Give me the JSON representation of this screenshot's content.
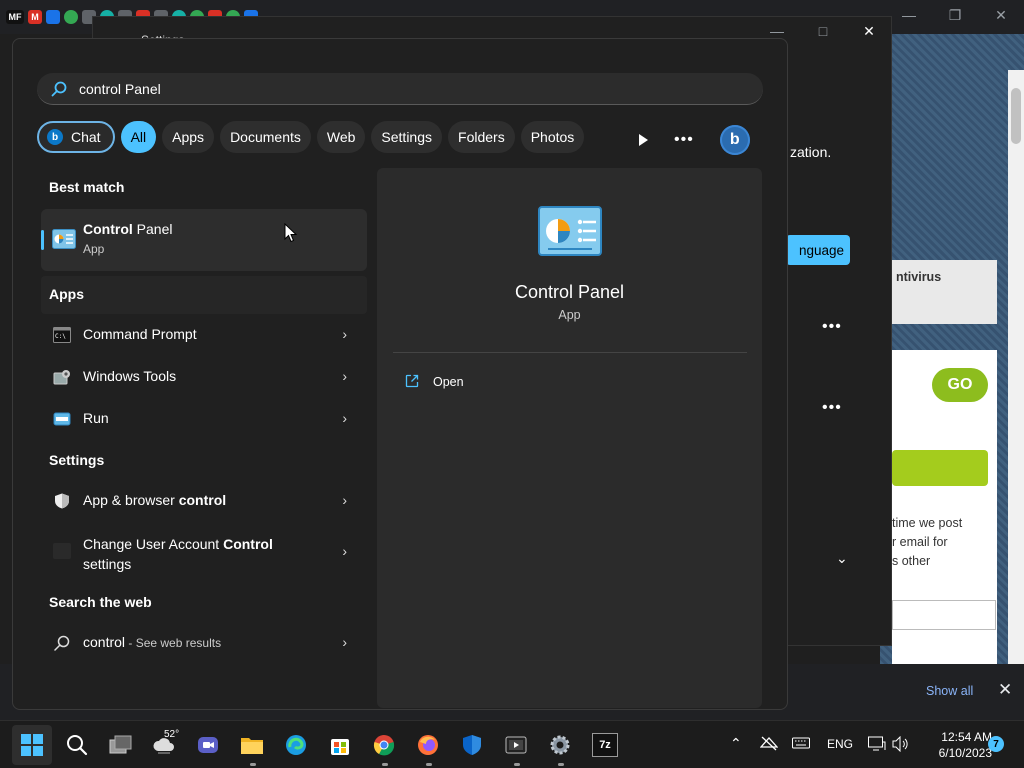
{
  "browser": {
    "tab_icons": [
      "MF",
      "M"
    ],
    "show_all": "Show all"
  },
  "settings_window": {
    "title": "Settings",
    "text_fragment": "zation.",
    "lang_button": "nguage"
  },
  "webpage": {
    "tab_label": "ntivirus",
    "go_button": "GO",
    "body_text": [
      "time we post",
      "r email for",
      "s other"
    ]
  },
  "search": {
    "query": "control Panel",
    "filters": [
      "Chat",
      "All",
      "Apps",
      "Documents",
      "Web",
      "Settings",
      "Folders",
      "Photos"
    ],
    "active_filter": "All"
  },
  "best_match": {
    "heading": "Best match",
    "title_bold": "Control",
    "title_rest": " Panel",
    "subtitle": "App"
  },
  "apps": {
    "heading": "Apps",
    "items": [
      "Command Prompt",
      "Windows Tools",
      "Run"
    ]
  },
  "settings": {
    "heading": "Settings",
    "items": [
      {
        "pre": "App & browser ",
        "bold": "control",
        "post": ""
      },
      {
        "pre": "Change User Account ",
        "bold": "Control",
        "post": " settings"
      }
    ]
  },
  "web": {
    "heading": "Search the web",
    "query": "control",
    "suffix": " - See web results"
  },
  "preview": {
    "name": "Control Panel",
    "type": "App",
    "action": "Open"
  },
  "taskbar": {
    "temperature": "52°",
    "language": "ENG",
    "time": "12:54 AM",
    "date": "6/10/2023",
    "notifications": "7",
    "sevenzip": "7z"
  },
  "colors": {
    "accent": "#4cc2ff",
    "panel_bg": "#202020"
  }
}
